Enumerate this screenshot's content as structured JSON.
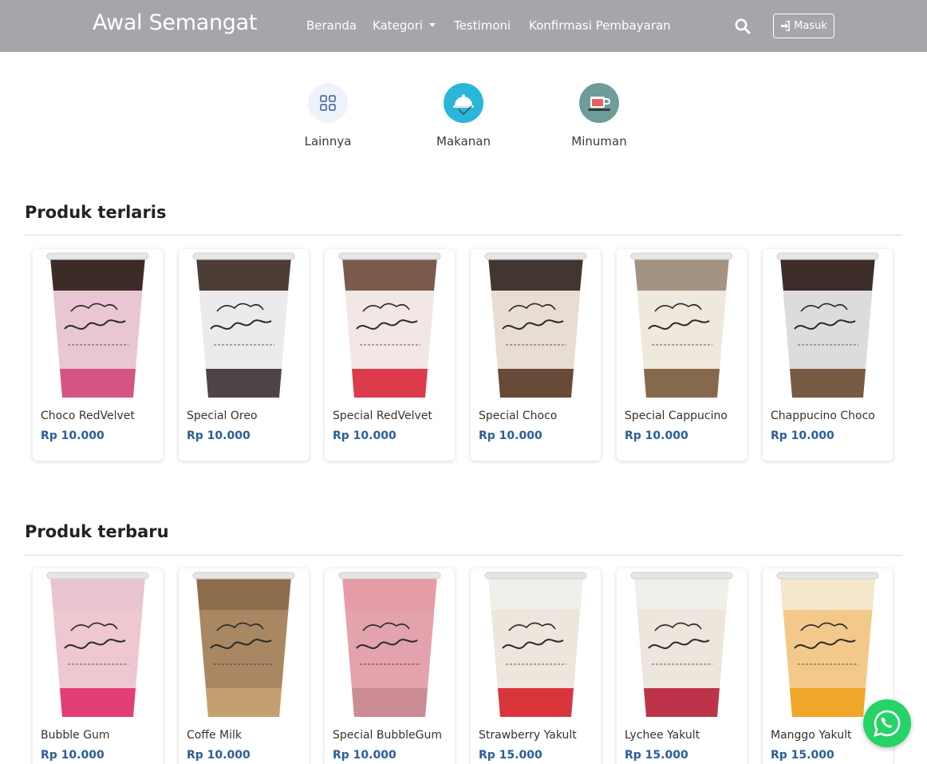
{
  "navbar": {
    "brand": "Awal Semangat",
    "links": {
      "home": "Beranda",
      "category": "Kategori",
      "testimonial": "Testimoni",
      "payment": "Konfirmasi Pembayaran"
    },
    "login_label": "Masuk",
    "bg_color": "#a4a6ab"
  },
  "categories": [
    {
      "label": "Lainnya",
      "icon": "grid-icon",
      "color": "#eef3fb"
    },
    {
      "label": "Makanan",
      "icon": "food-cloche-icon",
      "color": "#29b6d8"
    },
    {
      "label": "Minuman",
      "icon": "coffee-cup-icon",
      "color": "#6e9c98"
    }
  ],
  "bestsellers": {
    "title": "Produk terlaris",
    "items": [
      {
        "name": "Choco RedVelvet",
        "price": "Rp 10.000",
        "top": "#2a1a14",
        "body": "#e9c6d3",
        "bottom": "#d2487a"
      },
      {
        "name": "Special Oreo",
        "price": "Rp 10.000",
        "top": "#3b2a22",
        "body": "#eceaea",
        "bottom": "#3c3235"
      },
      {
        "name": "Special RedVelvet",
        "price": "Rp 10.000",
        "top": "#6b4a3a",
        "body": "#f2e6e6",
        "bottom": "#d8283a"
      },
      {
        "name": "Special Choco",
        "price": "Rp 10.000",
        "top": "#2f2420",
        "body": "#e8ddd2",
        "bottom": "#5a3a26"
      },
      {
        "name": "Special Cappucino",
        "price": "Rp 10.000",
        "top": "#9b8a78",
        "body": "#eee8dd",
        "bottom": "#7a5a3c"
      },
      {
        "name": "Chappucino Choco",
        "price": "Rp 10.000",
        "top": "#2a1a14",
        "body": "#dcdcdc",
        "bottom": "#6a4b33"
      }
    ]
  },
  "newest": {
    "title": "Produk terbaru",
    "items": [
      {
        "name": "Bubble Gum",
        "price": "Rp 10.000",
        "top": "#e8c4cf",
        "body": "#eec7d0",
        "bottom": "#e0306a"
      },
      {
        "name": "Coffe Milk",
        "price": "Rp 10.000",
        "top": "#8a6a4a",
        "body": "#a88762",
        "bottom": "#c9a273"
      },
      {
        "name": "Special BubbleGum",
        "price": "Rp 10.000",
        "top": "#e89aa5",
        "body": "#e2a3ad",
        "bottom": "#c98992"
      },
      {
        "name": "Strawberry Yakult",
        "price": "Rp 15.000",
        "top": "#f2f0ea",
        "body": "#ece6dc",
        "bottom": "#d8202a"
      },
      {
        "name": "Lychee Yakult",
        "price": "Rp 15.000",
        "top": "#f2f0ea",
        "body": "#ece6dc",
        "bottom": "#b8203a"
      },
      {
        "name": "Manggo Yakult",
        "price": "Rp 15.000",
        "top": "#f4ead2",
        "body": "#f3c98b",
        "bottom": "#f0a21e"
      }
    ]
  },
  "whatsapp_icon": "whatsapp-icon"
}
